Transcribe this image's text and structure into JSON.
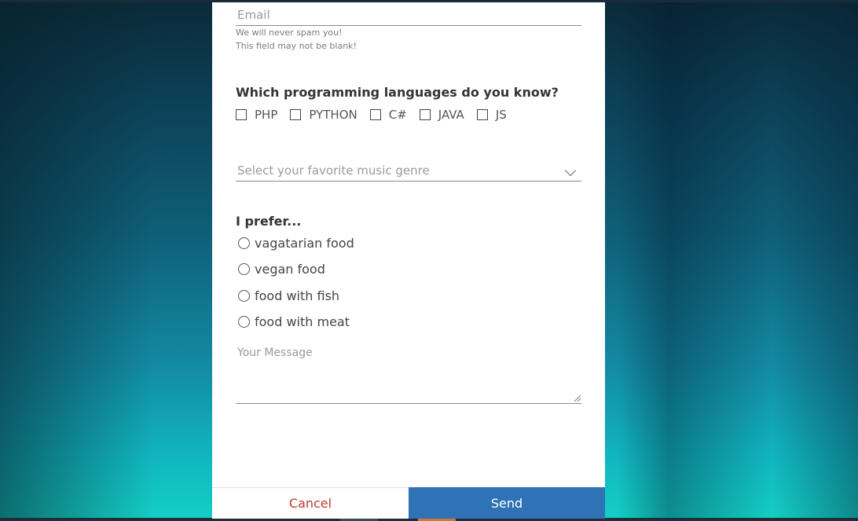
{
  "form": {
    "email": {
      "placeholder": "Email",
      "hint": "We will never spam you!",
      "error": "This field may not be blank!"
    },
    "languages": {
      "title": "Which programming languages do you know?",
      "options": [
        "PHP",
        "PYTHON",
        "C#",
        "JAVA",
        "JS"
      ]
    },
    "genre": {
      "placeholder": "Select your favorite music genre"
    },
    "food": {
      "title": "I prefer...",
      "options": [
        "vagatarian food",
        "vegan food",
        "food with fish",
        "food with meat"
      ]
    },
    "message": {
      "placeholder": "Your Message"
    },
    "buttons": {
      "cancel": "Cancel",
      "send": "Send"
    }
  },
  "colors": {
    "send_button": "#2f72b5",
    "cancel_text": "#c0392b"
  }
}
